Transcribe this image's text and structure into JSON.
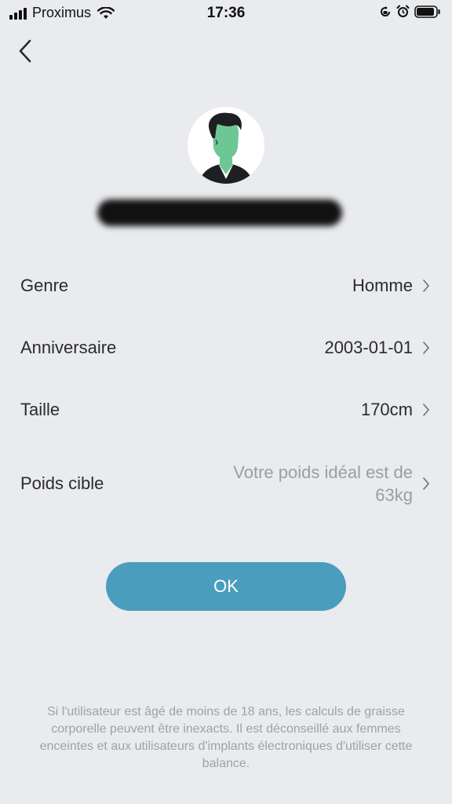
{
  "status_bar": {
    "carrier": "Proximus",
    "time": "17:36",
    "icons": [
      "signal-icon",
      "wifi-icon",
      "orientation-lock-icon",
      "alarm-icon",
      "battery-icon"
    ]
  },
  "header": {
    "back_icon": "chevron-left-icon"
  },
  "profile": {
    "avatar_icon": "male-user-avatar-icon",
    "name": ""
  },
  "fields": [
    {
      "label": "Genre",
      "value": "Homme"
    },
    {
      "label": "Anniversaire",
      "value": "2003-01-01"
    },
    {
      "label": "Taille",
      "value": "170cm"
    },
    {
      "label": "Poids cible",
      "value_line1": "Votre poids idéal est de",
      "value_line2": "63kg"
    }
  ],
  "ok_button": {
    "label": "OK"
  },
  "disclaimer": "Si l'utilisateur est âgé de moins de 18 ans, les calculs de graisse corporelle peuvent être inexacts. Il est déconseillé aux femmes enceintes et aux utilisateurs d'implants électroniques d'utiliser cette balance.",
  "colors": {
    "background": "#e9ebee",
    "accent": "#4a9dbd",
    "muted_text": "#9a9ea3"
  }
}
